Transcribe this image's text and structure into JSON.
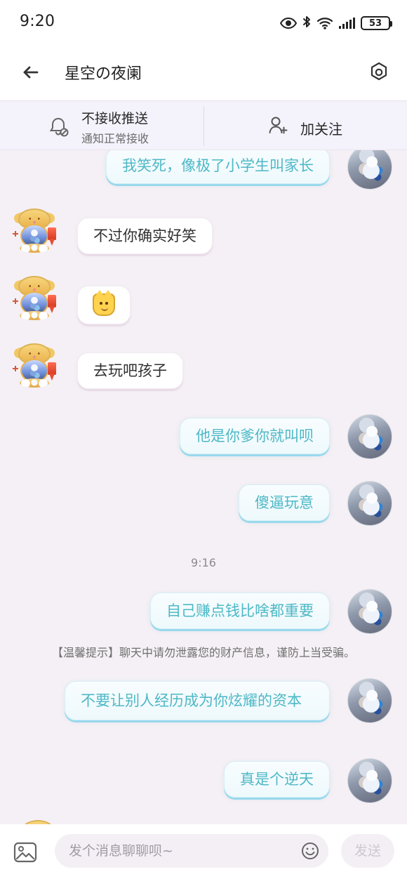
{
  "status_bar": {
    "time": "9:20",
    "battery": "53",
    "icons": [
      "eye-icon",
      "bluetooth-icon",
      "wifi-icon",
      "signal-icon",
      "battery-icon"
    ]
  },
  "header": {
    "title": "星空の夜阑",
    "back_icon": "arrow-left-icon",
    "settings_icon": "settings-icon"
  },
  "subbar": {
    "mute_title": "不接收推送",
    "mute_subtitle": "通知正常接收",
    "mute_icon": "bell-muted-icon",
    "follow_label": "加关注",
    "follow_icon": "user-plus-icon"
  },
  "chat": {
    "messages": [
      {
        "side": "me",
        "text": "我笑死，像极了小学生叫家长"
      },
      {
        "side": "friend",
        "text": "不过你确实好笑"
      },
      {
        "side": "friend",
        "emoji": "cat-emoji"
      },
      {
        "side": "friend",
        "text": "去玩吧孩子"
      },
      {
        "side": "me",
        "text": "他是你爹你就叫呗"
      },
      {
        "side": "me",
        "text": "傻逼玩意"
      },
      {
        "side": "system",
        "text": "9:16"
      },
      {
        "side": "me",
        "text": "自己赚点钱比啥都重要"
      },
      {
        "side": "system",
        "text": "【温馨提示】聊天中请勿泄露您的财产信息，谨防上当受骗。"
      },
      {
        "side": "me",
        "text": "不要让别人经历成为你炫耀的资本"
      },
      {
        "side": "me",
        "text": "真是个逆天"
      }
    ]
  },
  "composer": {
    "placeholder": "发个消息聊聊呗~",
    "send_label": "发送",
    "gallery_icon": "image-icon",
    "emoji_icon": "emoji-icon"
  },
  "colors": {
    "background": "#f4eff5",
    "self_bubble_text": "#4eb8c6",
    "self_bubble_border": "#9ad8ec",
    "friend_bubble_bg": "#ffffff"
  }
}
